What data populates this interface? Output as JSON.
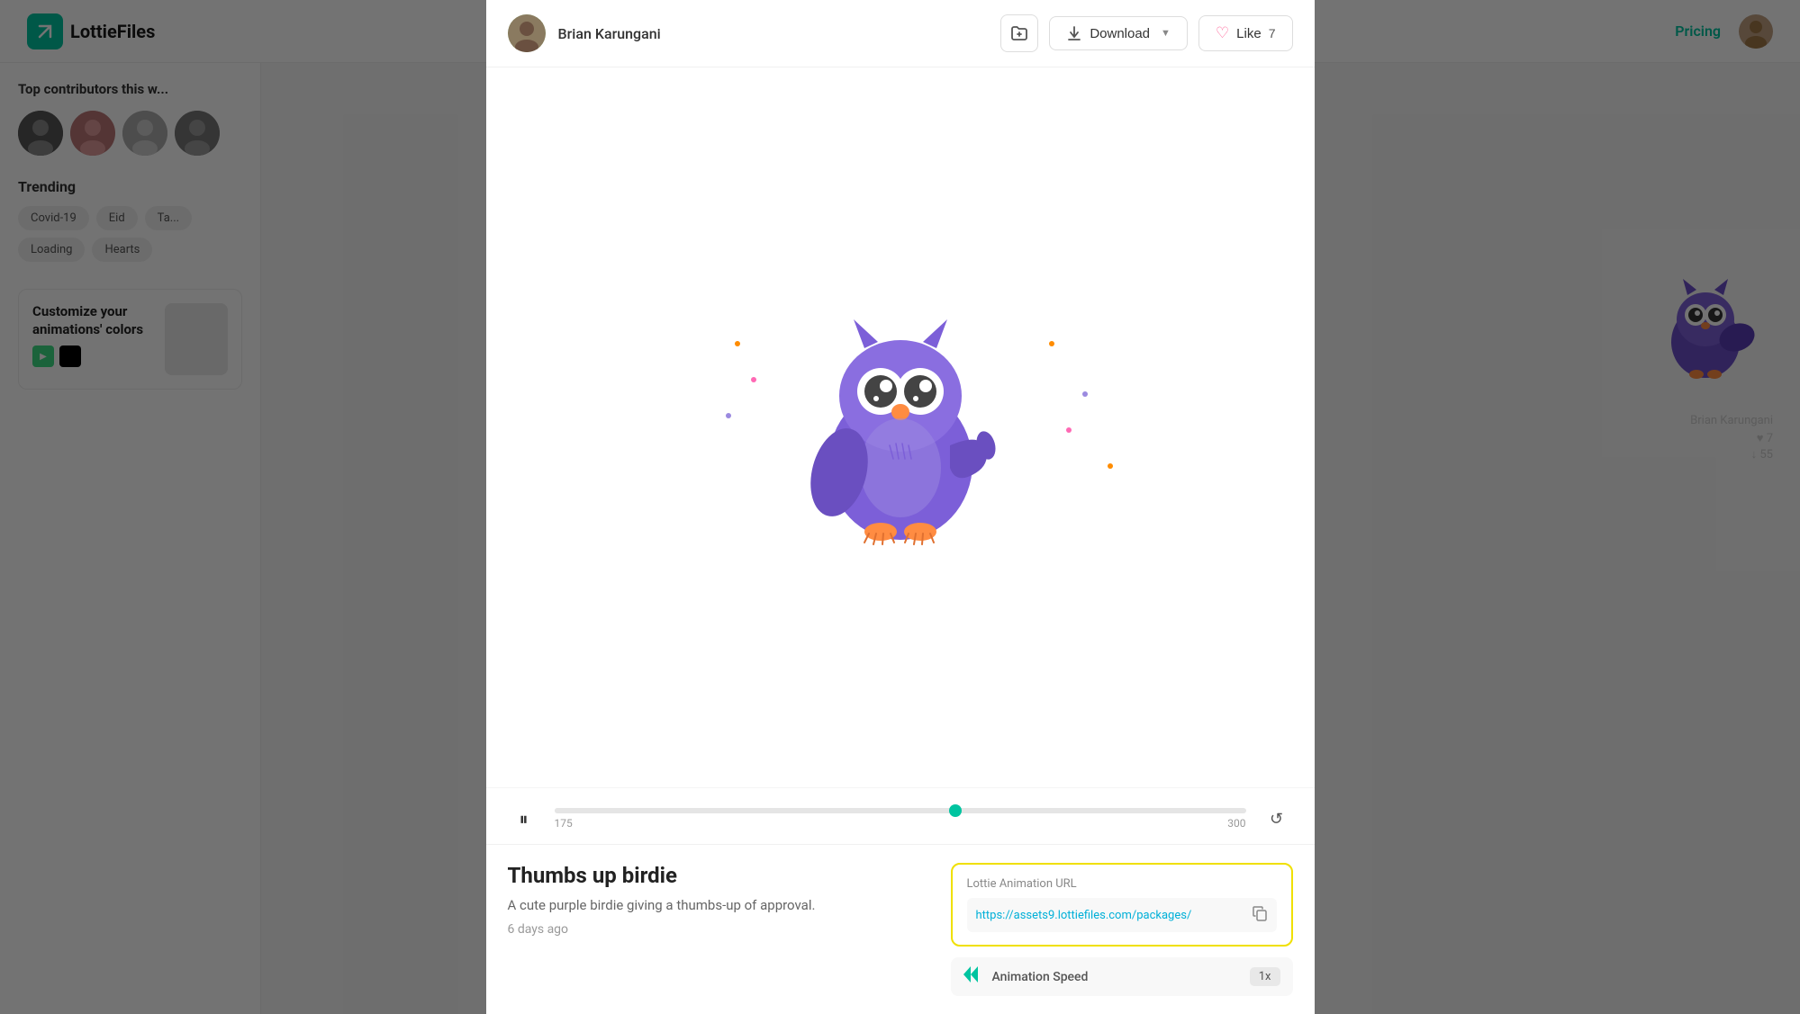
{
  "app": {
    "name": "LottieFiles",
    "logo_letter": "/"
  },
  "topnav": {
    "pricing_label": "Pricing"
  },
  "sidebar": {
    "contributors_title": "Top contributors this w...",
    "trending_title": "Trending",
    "tags": [
      "Covid-19",
      "Eid",
      "Ta...",
      "Loading",
      "Hearts"
    ],
    "customize_title": "Customize your animations' colors"
  },
  "modal": {
    "user_name": "Brian Karungani",
    "download_label": "Download",
    "like_label": "Like",
    "like_count": "7",
    "animation_title": "Thumbs up birdie",
    "animation_desc": "A cute purple birdie giving a thumbs-up of approval.",
    "animation_date": "6 days ago",
    "url_label": "Lottie Animation URL",
    "url_value": "https://assets9.lottiefiles.com/packages/",
    "copy_tooltip": "Copy",
    "speed_label": "Animation Speed",
    "speed_value": "1x",
    "timeline_start": "175",
    "timeline_end": "300"
  },
  "side_info": {
    "creator": "Brian Karungani",
    "likes": "♥ 7",
    "downloads": "↓ 55"
  }
}
